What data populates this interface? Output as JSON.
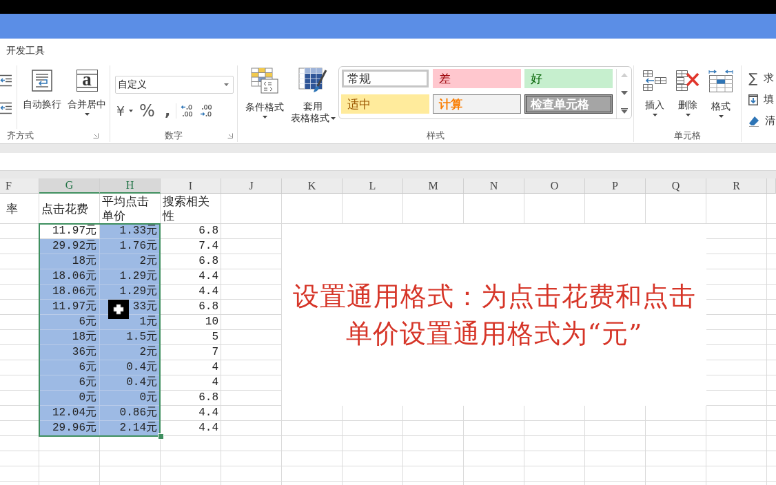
{
  "tabs": [
    {
      "label": "开发工具",
      "selected": false
    }
  ],
  "alignment": {
    "group_label": "齐方式",
    "wrap_text": {
      "label": "自动换行"
    },
    "merge_center": {
      "label": "合并居中",
      "glyph": "a"
    }
  },
  "number": {
    "group_label": "数字",
    "format": {
      "value": "自定义"
    },
    "currency": "¥",
    "percent": "%",
    "comma": ","
  },
  "styles": {
    "group_label": "样式",
    "conditional_formatting": {
      "label": "条件格式"
    },
    "format_as_table": {
      "label": "套用表格格式"
    },
    "gallery": [
      {
        "label": "常规",
        "kind": "normal",
        "selected": true
      },
      {
        "label": "差",
        "kind": "bad",
        "selected": false
      },
      {
        "label": "好",
        "kind": "good",
        "selected": false
      },
      {
        "label": "适中",
        "kind": "neutral",
        "selected": false
      },
      {
        "label": "计算",
        "kind": "calculation",
        "selected": false
      },
      {
        "label": "检查单元格",
        "kind": "check",
        "selected": false
      }
    ]
  },
  "cells": {
    "group_label": "单元格",
    "insert": {
      "label": "插入"
    },
    "delete": {
      "label": "删除"
    },
    "format": {
      "label": "格式"
    }
  },
  "editing": {
    "autosum": {
      "symbol": "∑",
      "label": "求"
    },
    "fill": {
      "label": "填"
    },
    "clear": {
      "label": "清"
    }
  },
  "sheet": {
    "columns": [
      {
        "letter": "F",
        "selected": false
      },
      {
        "letter": "G",
        "selected": true
      },
      {
        "letter": "H",
        "selected": true
      },
      {
        "letter": "I",
        "selected": false
      },
      {
        "letter": "J",
        "selected": false
      },
      {
        "letter": "K",
        "selected": false
      },
      {
        "letter": "L",
        "selected": false
      },
      {
        "letter": "M",
        "selected": false
      },
      {
        "letter": "N",
        "selected": false
      },
      {
        "letter": "O",
        "selected": false
      },
      {
        "letter": "P",
        "selected": false
      },
      {
        "letter": "Q",
        "selected": false
      },
      {
        "letter": "R",
        "selected": false
      }
    ],
    "header_row": [
      "率",
      "点击花费",
      "平均点击单价",
      "搜索相关性"
    ],
    "rows": [
      {
        "cells": [
          {
            "selected": false,
            "active": false
          },
          {
            "text": "11.97元",
            "selected": true,
            "active": true
          },
          {
            "text": "1.33元",
            "selected": true,
            "active": false
          },
          {
            "text": "6.8",
            "selected": false,
            "active": false
          }
        ]
      },
      {
        "cells": [
          {
            "selected": false,
            "active": false
          },
          {
            "text": "29.92元",
            "selected": true,
            "active": false
          },
          {
            "text": "1.76元",
            "selected": true,
            "active": false
          },
          {
            "text": "7.4",
            "selected": false,
            "active": false
          }
        ]
      },
      {
        "cells": [
          {
            "selected": false,
            "active": false
          },
          {
            "text": "18元",
            "selected": true,
            "active": false
          },
          {
            "text": "2元",
            "selected": true,
            "active": false
          },
          {
            "text": "6.8",
            "selected": false,
            "active": false
          }
        ]
      },
      {
        "cells": [
          {
            "selected": false,
            "active": false
          },
          {
            "text": "18.06元",
            "selected": true,
            "active": false
          },
          {
            "text": "1.29元",
            "selected": true,
            "active": false
          },
          {
            "text": "4.4",
            "selected": false,
            "active": false
          }
        ]
      },
      {
        "cells": [
          {
            "selected": false,
            "active": false
          },
          {
            "text": "18.06元",
            "selected": true,
            "active": false
          },
          {
            "text": "1.29元",
            "selected": true,
            "active": false
          },
          {
            "text": "4.4",
            "selected": false,
            "active": false
          }
        ]
      },
      {
        "cells": [
          {
            "selected": false,
            "active": false
          },
          {
            "text": "11.97元",
            "selected": true,
            "active": false
          },
          {
            "text": "33元",
            "selected": true,
            "active": false
          },
          {
            "text": "6.8",
            "selected": false,
            "active": false
          }
        ]
      },
      {
        "cells": [
          {
            "selected": false,
            "active": false
          },
          {
            "text": "6元",
            "selected": true,
            "active": false
          },
          {
            "text": "1元",
            "selected": true,
            "active": false
          },
          {
            "text": "10",
            "selected": false,
            "active": false
          }
        ]
      },
      {
        "cells": [
          {
            "selected": false,
            "active": false
          },
          {
            "text": "18元",
            "selected": true,
            "active": false
          },
          {
            "text": "1.5元",
            "selected": true,
            "active": false
          },
          {
            "text": "5",
            "selected": false,
            "active": false
          }
        ]
      },
      {
        "cells": [
          {
            "selected": false,
            "active": false
          },
          {
            "text": "36元",
            "selected": true,
            "active": false
          },
          {
            "text": "2元",
            "selected": true,
            "active": false
          },
          {
            "text": "7",
            "selected": false,
            "active": false
          }
        ]
      },
      {
        "cells": [
          {
            "selected": false,
            "active": false
          },
          {
            "text": "6元",
            "selected": true,
            "active": false
          },
          {
            "text": "0.4元",
            "selected": true,
            "active": false
          },
          {
            "text": "4",
            "selected": false,
            "active": false
          }
        ]
      },
      {
        "cells": [
          {
            "selected": false,
            "active": false
          },
          {
            "text": "6元",
            "selected": true,
            "active": false
          },
          {
            "text": "0.4元",
            "selected": true,
            "active": false
          },
          {
            "text": "4",
            "selected": false,
            "active": false
          }
        ]
      },
      {
        "cells": [
          {
            "selected": false,
            "active": false
          },
          {
            "text": "0元",
            "selected": true,
            "active": false
          },
          {
            "text": "0元",
            "selected": true,
            "active": false
          },
          {
            "text": "6.8",
            "selected": false,
            "active": false
          }
        ]
      },
      {
        "cells": [
          {
            "selected": false,
            "active": false
          },
          {
            "text": "12.04元",
            "selected": true,
            "active": false
          },
          {
            "text": "0.86元",
            "selected": true,
            "active": false
          },
          {
            "text": "4.4",
            "selected": false,
            "active": false
          }
        ]
      },
      {
        "cells": [
          {
            "selected": false,
            "active": false
          },
          {
            "text": "29.96元",
            "selected": true,
            "active": false
          },
          {
            "text": "2.14元",
            "selected": true,
            "active": false
          },
          {
            "text": "4.4",
            "selected": false,
            "active": false
          }
        ]
      }
    ]
  },
  "text_box": {
    "text": "设置通用格式：为点击花费和点击单价设置通用格式为“元”"
  }
}
